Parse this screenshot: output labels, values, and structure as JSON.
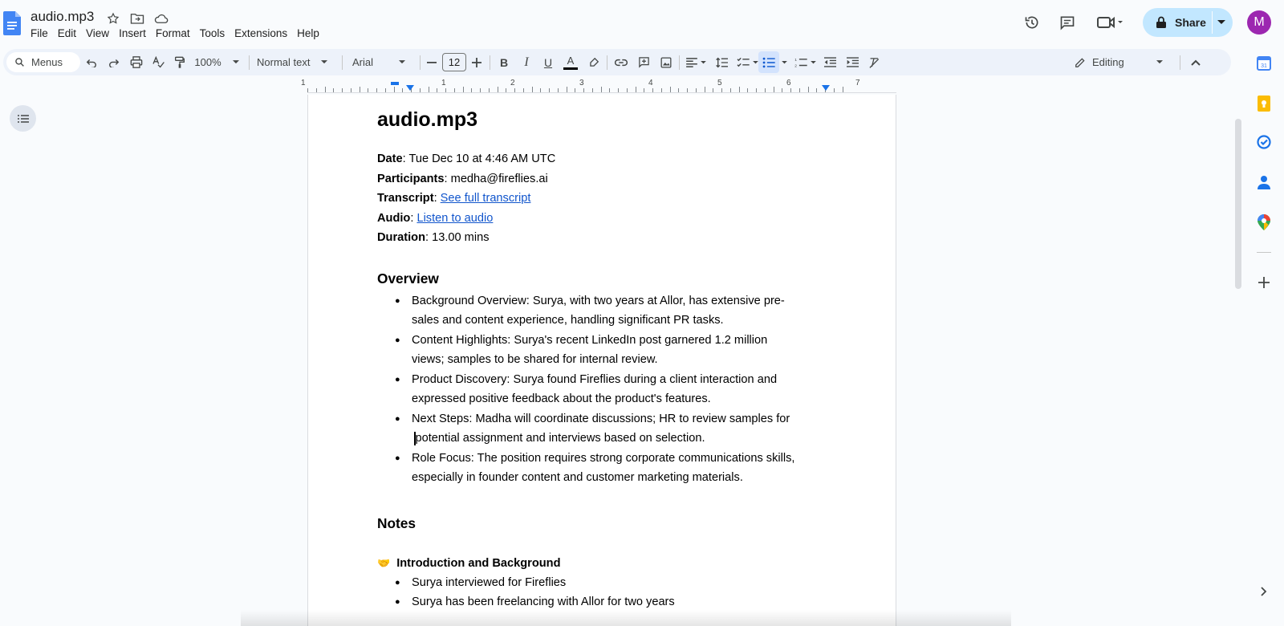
{
  "document": {
    "title": "audio.mp3"
  },
  "menu": [
    "File",
    "Edit",
    "View",
    "Insert",
    "Format",
    "Tools",
    "Extensions",
    "Help"
  ],
  "header_actions": {
    "share_label": "Share",
    "avatar_letter": "M"
  },
  "toolbar": {
    "search_label": "Menus",
    "zoom": "100%",
    "style": "Normal text",
    "font": "Arial",
    "font_size": "12",
    "mode": "Editing"
  },
  "ruler": {
    "numbers": [
      "1",
      "1",
      "2",
      "3",
      "4",
      "5",
      "6",
      "7"
    ]
  },
  "doc": {
    "heading": "audio.mp3",
    "meta": {
      "date_label": "Date",
      "date_value": ": Tue Dec 10 at 4:46 AM UTC",
      "participants_label": "Participants",
      "participants_value": ": medha@fireflies.ai",
      "transcript_label": "Transcript",
      "transcript_sep": ": ",
      "transcript_link": "See full transcript",
      "audio_label": "Audio",
      "audio_sep": ": ",
      "audio_link": "Listen to audio",
      "duration_label": "Duration",
      "duration_value": ": 13.00 mins"
    },
    "overview_heading": "Overview",
    "overview": [
      "Background Overview: Surya, with two years at Allor, has extensive pre-sales and content experience, handling significant PR tasks.",
      "Content Highlights: Surya's recent LinkedIn post garnered 1.2 million views; samples to be shared for internal review.",
      "Product Discovery: Surya found Fireflies during a client interaction and expressed positive feedback about the product's features.",
      "Next Steps: Madha will coordinate discussions; HR to review samples for potential assignment and interviews based on selection.",
      "Role Focus: The position requires strong corporate communications skills, especially in founder content and customer marketing materials."
    ],
    "notes_heading": "Notes",
    "notes_section": {
      "emoji": "🤝",
      "title": "Introduction and Background",
      "items": [
        "Surya interviewed for Fireflies",
        "Surya has been freelancing with Allor for two years"
      ]
    }
  },
  "colors": {
    "share_bg": "#c2e7ff",
    "toolbar_bg": "#edf2fa",
    "link": "#1155cc",
    "avatar_bg": "#9c27b0"
  }
}
